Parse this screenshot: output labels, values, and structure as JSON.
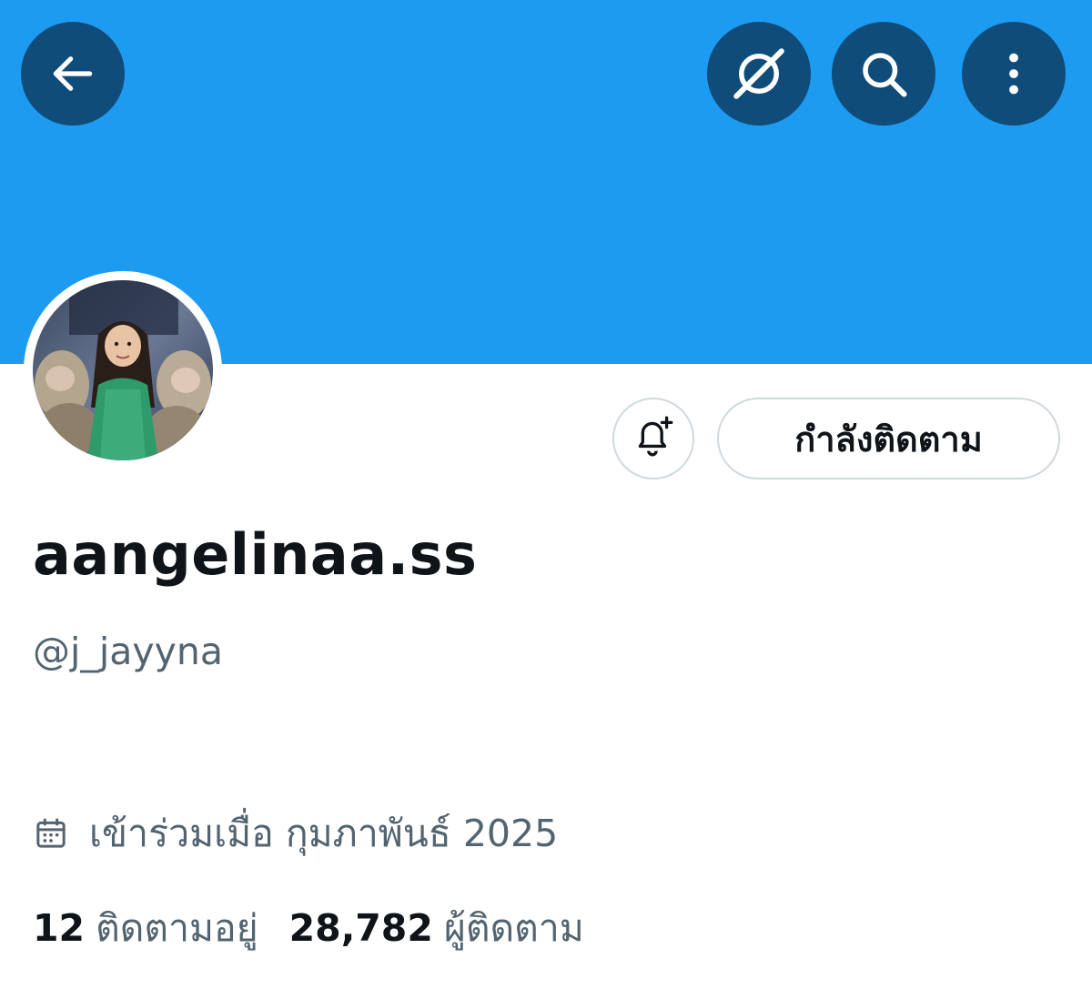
{
  "header": {
    "back_icon": "arrow-left-icon",
    "grok_icon": "grok-icon",
    "search_icon": "search-icon",
    "more_icon": "more-vertical-icon",
    "banner_color": "#1d9bf0",
    "button_bg": "#0f4c79"
  },
  "profile": {
    "display_name": "aangelinaa.ss",
    "handle": "@j_jayyna",
    "joined": "เข้าร่วมเมื่อ กุมภาพันธ์ 2025",
    "following_count": "12",
    "following_label": "ติดตามอยู่",
    "followers_count": "28,782",
    "followers_label": "ผู้ติดตาม"
  },
  "actions": {
    "notify_icon": "bell-plus-icon",
    "following_button_label": "กำลังติดตาม"
  },
  "colors": {
    "text_primary": "#0f1419",
    "text_secondary": "#536471",
    "border": "#cfd9de"
  }
}
